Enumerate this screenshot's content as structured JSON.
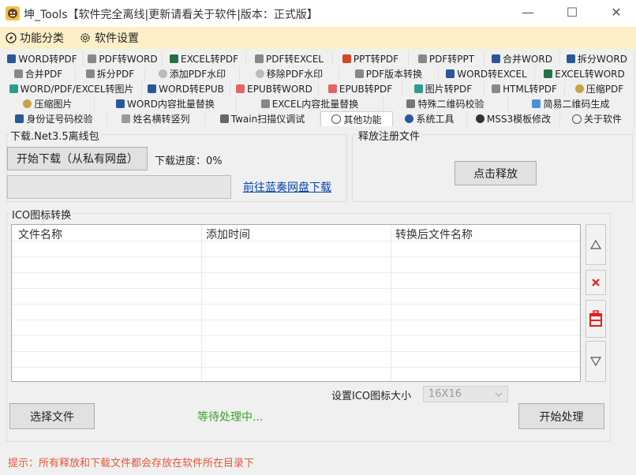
{
  "window": {
    "title": "坤_Tools【软件完全离线|更新请看关于软件|版本：正式版】",
    "minimize": "—",
    "maximize": "☐",
    "close": "✕"
  },
  "menu": {
    "category": "功能分类",
    "settings": "软件设置"
  },
  "tabs": {
    "row1": [
      "WORD转PDF",
      "PDF转WORD",
      "EXCEL转PDF",
      "PDF转EXCEL",
      "PPT转PDF",
      "PDF转PPT",
      "合并WORD",
      "拆分WORD"
    ],
    "row2": [
      "合并PDF",
      "拆分PDF",
      "添加PDF水印",
      "移除PDF水印",
      "PDF版本转换",
      "WORD转EXCEL",
      "EXCEL转WORD"
    ],
    "row3": [
      "WORD/PDF/EXCEL转图片",
      "WORD转EPUB",
      "EPUB转WORD",
      "EPUB转PDF",
      "图片转PDF",
      "HTML转PDF",
      "压缩PDF"
    ],
    "row4": [
      "压缩图片",
      "WORD内容批量替换",
      "EXCEL内容批量替换",
      "特殊二维码校验",
      "简易二维码生成"
    ],
    "row5": [
      "身份证号码校验",
      "姓名横转竖列",
      "Twain扫描仪调试",
      "其他功能",
      "系统工具",
      "MSS3模板修改",
      "关于软件"
    ]
  },
  "download": {
    "legend": "下载.Net3.5离线包",
    "start_button": "开始下载（从私有网盘）",
    "progress_label": "下载进度：0%",
    "progress": 0,
    "link": "前往蓝奏网盘下载"
  },
  "release": {
    "legend": "释放注册文件",
    "button": "点击释放"
  },
  "ico": {
    "legend": "ICO图标转换",
    "columns": [
      "文件名称",
      "添加时间",
      "转换后文件名称"
    ],
    "size_label": "设置ICO图标大小",
    "size_value": "16X16",
    "select_button": "选择文件",
    "status": "等待处理中...",
    "process_button": "开始处理"
  },
  "tip": "提示：所有释放和下载文件都会存放在软件所在目录下",
  "colors": {
    "menubar_bg": "#fdf0c8",
    "status_green": "#3aa02a",
    "tip_red": "#e8563a",
    "link_blue": "#0645ad"
  }
}
